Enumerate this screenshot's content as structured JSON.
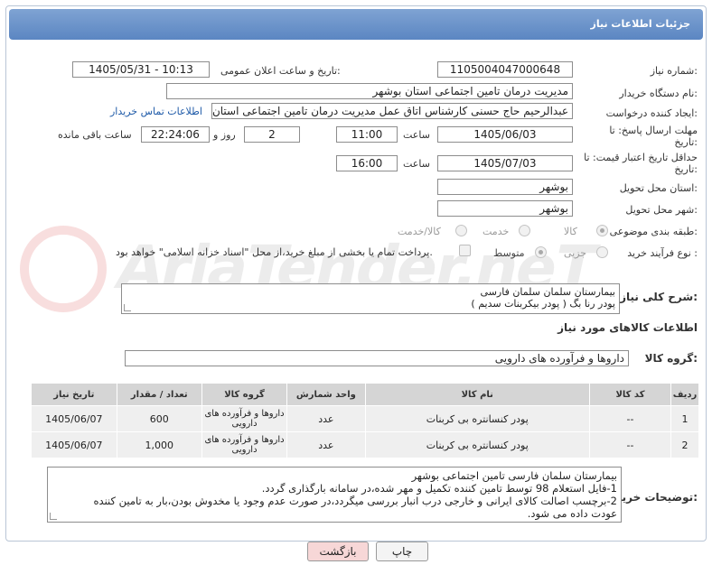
{
  "header": {
    "title": "جزئیات اطلاعات نیاز"
  },
  "fields": {
    "need_number_label": "شماره نیاز:",
    "need_number": "1105004047000648",
    "announce_label": "تاریخ و ساعت اعلان عمومی:",
    "announce_value": "1405/05/31 - 10:13",
    "buyer_label": "نام دستگاه خریدار:",
    "buyer_value": "مدیریت درمان تامین اجتماعی استان بوشهر",
    "creator_label": "ایجاد کننده درخواست:",
    "creator_value": "عبدالرحیم حاج حسنی کارشناس اتاق عمل مدیریت درمان تامین اجتماعی استان بوشهر",
    "contact_link": "اطلاعات تماس خریدار",
    "send_deadline_label": "مهلت ارسال پاسخ: تا تاریخ:",
    "send_date": "1405/06/03",
    "time_label": "ساعت",
    "send_time": "11:00",
    "days_value": "2",
    "days_label": "روز و",
    "remaining_time": "22:24:06",
    "remaining_label": "ساعت باقی مانده",
    "price_deadline_label": "حداقل تاریخ اعتبار قیمت: تا تاریخ:",
    "price_date": "1405/07/03",
    "price_time": "16:00",
    "province_label": "استان محل تحویل:",
    "province_value": "بوشهر",
    "city_label": "شهر محل تحویل:",
    "city_value": "بوشهر",
    "category_label": "طبقه بندی موضوعی:",
    "category_options": [
      "کالا",
      "خدمت",
      "کالا/خدمت"
    ],
    "category_selected": "کالا",
    "process_label": "نوع فرآیند خرید :",
    "process_options": [
      "جزیی",
      "متوسط"
    ],
    "process_selected": "متوسط",
    "payment_note": "پرداخت تمام یا بخشی از مبلغ خرید،از محل \"اسناد خزانه اسلامی\" خواهد بود."
  },
  "description": {
    "label": "شرح کلی نیاز:",
    "line1": "بیمارستان سلمان سلمان فارسی",
    "line2": "پودر رنا بگ ( پودر بیکربنات سدیم )"
  },
  "goods": {
    "section_title": "اطلاعات کالاهای مورد نیاز",
    "group_label": "گروه کالا:",
    "group_value": "داروها و فرآورده های دارویی",
    "columns": [
      "ردیف",
      "کد کالا",
      "نام کالا",
      "واحد شمارش",
      "گروه کالا",
      "تعداد / مقدار",
      "تاریخ نیاز"
    ],
    "rows": [
      {
        "row": "1",
        "code": "--",
        "name": "پودر کنسانتره بی کربنات",
        "unit": "عدد",
        "group": "داروها و فرآورده های دارویی",
        "qty": "600",
        "date": "1405/06/07"
      },
      {
        "row": "2",
        "code": "--",
        "name": "پودر کنسانتره بی کربنات",
        "unit": "عدد",
        "group": "داروها و فرآورده های دارویی",
        "qty": "1,000",
        "date": "1405/06/07"
      }
    ]
  },
  "buyer_notes": {
    "label": "توضیحات خریدار:",
    "line1": "بیمارستان سلمان فارسی تامین اجتماعی بوشهر",
    "line2": "1-فایل استعلام 98 توسط تامین کننده تکمیل و مهر شده،در سامانه بارگذاری گردد.",
    "line3": "2-برچسب اصالت کالای ایرانی و خارجی درب انبار بررسی میگردد،در صورت عدم وجود یا مخدوش بودن،بار به تامین کننده",
    "line4": "عودت داده می شود."
  },
  "buttons": {
    "print": "چاپ",
    "back": "بازگشت"
  },
  "watermark": "AriaTender.neT",
  "colors": {
    "header": "#5b86c2",
    "link": "#1e5aa8",
    "back_button": "#f7d7d7",
    "print_button": "#f4f4f4"
  }
}
